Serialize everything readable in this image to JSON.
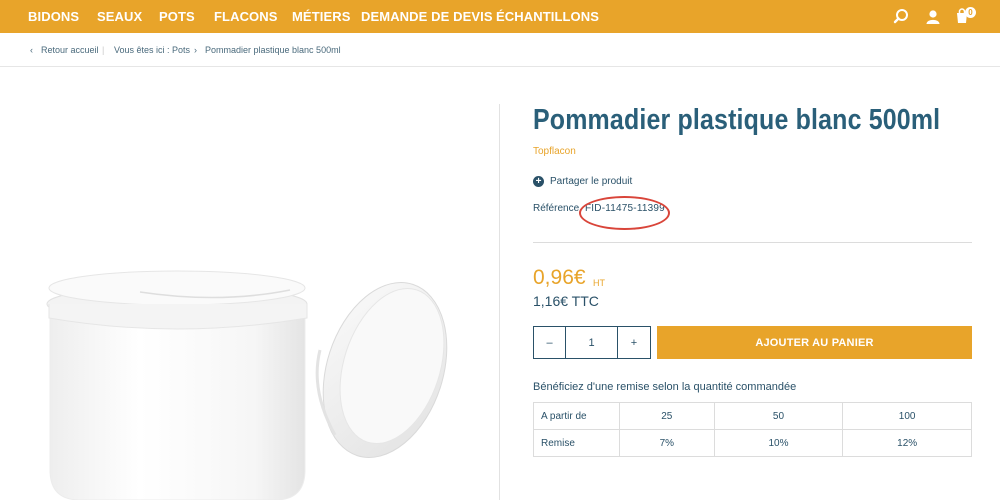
{
  "nav": {
    "items": [
      "BIDONS",
      "SEAUX",
      "POTS",
      "FLACONS",
      "MÉTIERS",
      "DEMANDE DE DEVIS",
      "ÉCHANTILLONS"
    ],
    "cart_count": "0",
    "icons": [
      "search-icon",
      "user-icon",
      "cart-icon"
    ]
  },
  "breadcrumb": {
    "back": "Retour accueil",
    "here": "Vous êtes ici :",
    "category": "Pots",
    "current": "Pommadier plastique blanc 500ml"
  },
  "product": {
    "title": "Pommadier plastique blanc 500ml",
    "brand": "Topflacon",
    "share_label": "Partager le produit",
    "reference_label": "Référence",
    "reference_value": "FID-11475-11399",
    "price_ht": "0,96€",
    "price_ht_unit": "HT",
    "price_ttc": "1,16€ TTC",
    "quantity": "1",
    "qty_minus": "–",
    "qty_plus": "+",
    "add_to_cart": "AJOUTER AU PANIER"
  },
  "discount": {
    "title": "Bénéficiez d'une remise selon la quantité commandée",
    "rows": [
      {
        "label": "A partir de",
        "values": [
          "25",
          "50",
          "100"
        ]
      },
      {
        "label": "Remise",
        "values": [
          "7%",
          "10%",
          "12%"
        ]
      }
    ]
  },
  "colors": {
    "accent": "#e8a42a",
    "primary": "#2a5168",
    "annotation": "#d9453a"
  }
}
